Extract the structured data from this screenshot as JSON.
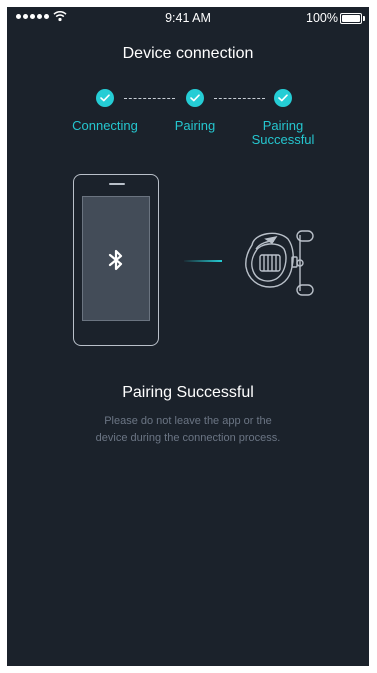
{
  "status_bar": {
    "time": "9:41 AM",
    "battery_percent": "100%",
    "battery_level": 1.0,
    "icons": [
      "signal-dots-icon",
      "wifi-icon",
      "battery-icon"
    ]
  },
  "header": {
    "title": "Device connection"
  },
  "steps": [
    {
      "label_line1": "Connecting",
      "label_line2": "",
      "completed": true
    },
    {
      "label_line1": "Pairing",
      "label_line2": "",
      "completed": true
    },
    {
      "label_line1": "Pairing",
      "label_line2": "Successful",
      "completed": true
    }
  ],
  "illustration": {
    "icons": [
      "phone-icon",
      "bluetooth-icon",
      "fishing-reel-icon"
    ]
  },
  "result": {
    "title": "Pairing Successful",
    "hint_line1": "Please do not leave the app or the",
    "hint_line2": "device during the connection process."
  },
  "colors": {
    "background": "#1b222b",
    "accent": "#25cdd5",
    "muted_text": "#6b7584"
  }
}
